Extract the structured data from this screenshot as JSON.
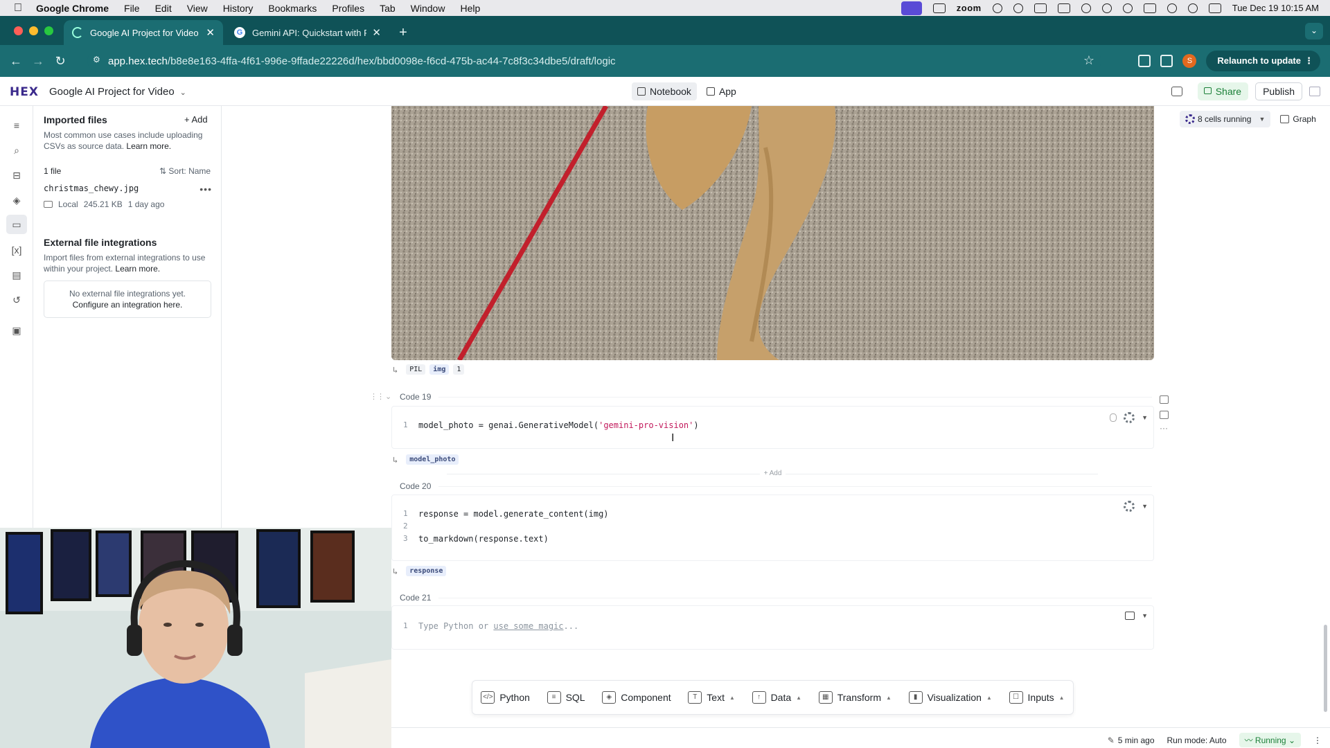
{
  "menubar": {
    "app_name": "Google Chrome",
    "items": [
      "File",
      "Edit",
      "View",
      "History",
      "Bookmarks",
      "Profiles",
      "Tab",
      "Window",
      "Help"
    ],
    "zoom_label": "zoom",
    "datetime": "Tue Dec 19  10:15 AM"
  },
  "browser": {
    "tabs": [
      {
        "title": "Google AI Project for Video",
        "active": true,
        "favicon": "hex-loading-icon"
      },
      {
        "title": "Gemini API: Quickstart with P",
        "active": false,
        "favicon": "google-icon"
      }
    ],
    "url_host": "app.hex.tech",
    "url_path": "/b8e8e163-4ffa-4f61-996e-9ffade22226d/hex/bbd0098e-f6cd-475b-ac44-7c8f3c34dbe5/draft/logic",
    "profile_initial": "S",
    "relaunch_label": "Relaunch to update"
  },
  "hex": {
    "logo": "HEX",
    "project_title": "Google AI Project for Video",
    "modes": [
      "Notebook",
      "App"
    ],
    "share_label": "Share",
    "publish_label": "Publish",
    "cells_running": "8 cells running",
    "graph_label": "Graph"
  },
  "files_panel": {
    "title": "Imported files",
    "add_label": "Add",
    "desc": "Most common use cases include uploading CSVs as source data.",
    "learn_more": "Learn more.",
    "count": "1 file",
    "sort_label": "Sort: Name",
    "file": {
      "name": "christmas_chewy.jpg",
      "location": "Local",
      "size": "245.21 KB",
      "modified": "1 day ago"
    },
    "ext_title": "External file integrations",
    "ext_desc": "Import files from external integrations to use within your project.",
    "ext_learn_more": "Learn more.",
    "ext_empty": "No external file integrations yet.",
    "ext_configure": "Configure an integration here."
  },
  "notebook": {
    "image_output": {
      "type_label": "PIL",
      "var": "img",
      "count": "1"
    },
    "cells": [
      {
        "label": "Code 19",
        "lines": [
          {
            "n": "1",
            "pre": "model_photo = genai.GenerativeModel(",
            "str": "'gemini-pro-vision'",
            "post": ")"
          }
        ],
        "output_var": "model_photo"
      },
      {
        "label": "Code 20",
        "lines": [
          {
            "n": "1",
            "pre": "response = model.generate_content(img)"
          },
          {
            "n": "2",
            "pre": ""
          },
          {
            "n": "3",
            "pre": "to_markdown(response.text)"
          }
        ],
        "output_var": "response"
      },
      {
        "label": "Code 21",
        "placeholder_pre": "Type Python or ",
        "placeholder_link": "use some magic",
        "placeholder_post": "...",
        "line_n": "1"
      }
    ],
    "add_label": "+ Add"
  },
  "add_cell_toolbar": [
    {
      "label": "Python",
      "icon": "code-icon"
    },
    {
      "label": "SQL",
      "icon": "database-icon"
    },
    {
      "label": "Component",
      "icon": "layers-icon"
    },
    {
      "label": "Text",
      "icon": "text-icon",
      "menu": true
    },
    {
      "label": "Data",
      "icon": "upload-icon",
      "menu": true
    },
    {
      "label": "Transform",
      "icon": "table-icon",
      "menu": true
    },
    {
      "label": "Visualization",
      "icon": "bar-chart-icon",
      "menu": true
    },
    {
      "label": "Inputs",
      "icon": "input-icon",
      "menu": true
    }
  ],
  "statusbar": {
    "last_saved": "5 min ago",
    "run_mode": "Run mode: Auto",
    "running": "Running"
  },
  "colors": {
    "hex_purple": "#3b2a8c",
    "chrome_teal": "#1b6d72",
    "running_green": "#1a7f37"
  }
}
